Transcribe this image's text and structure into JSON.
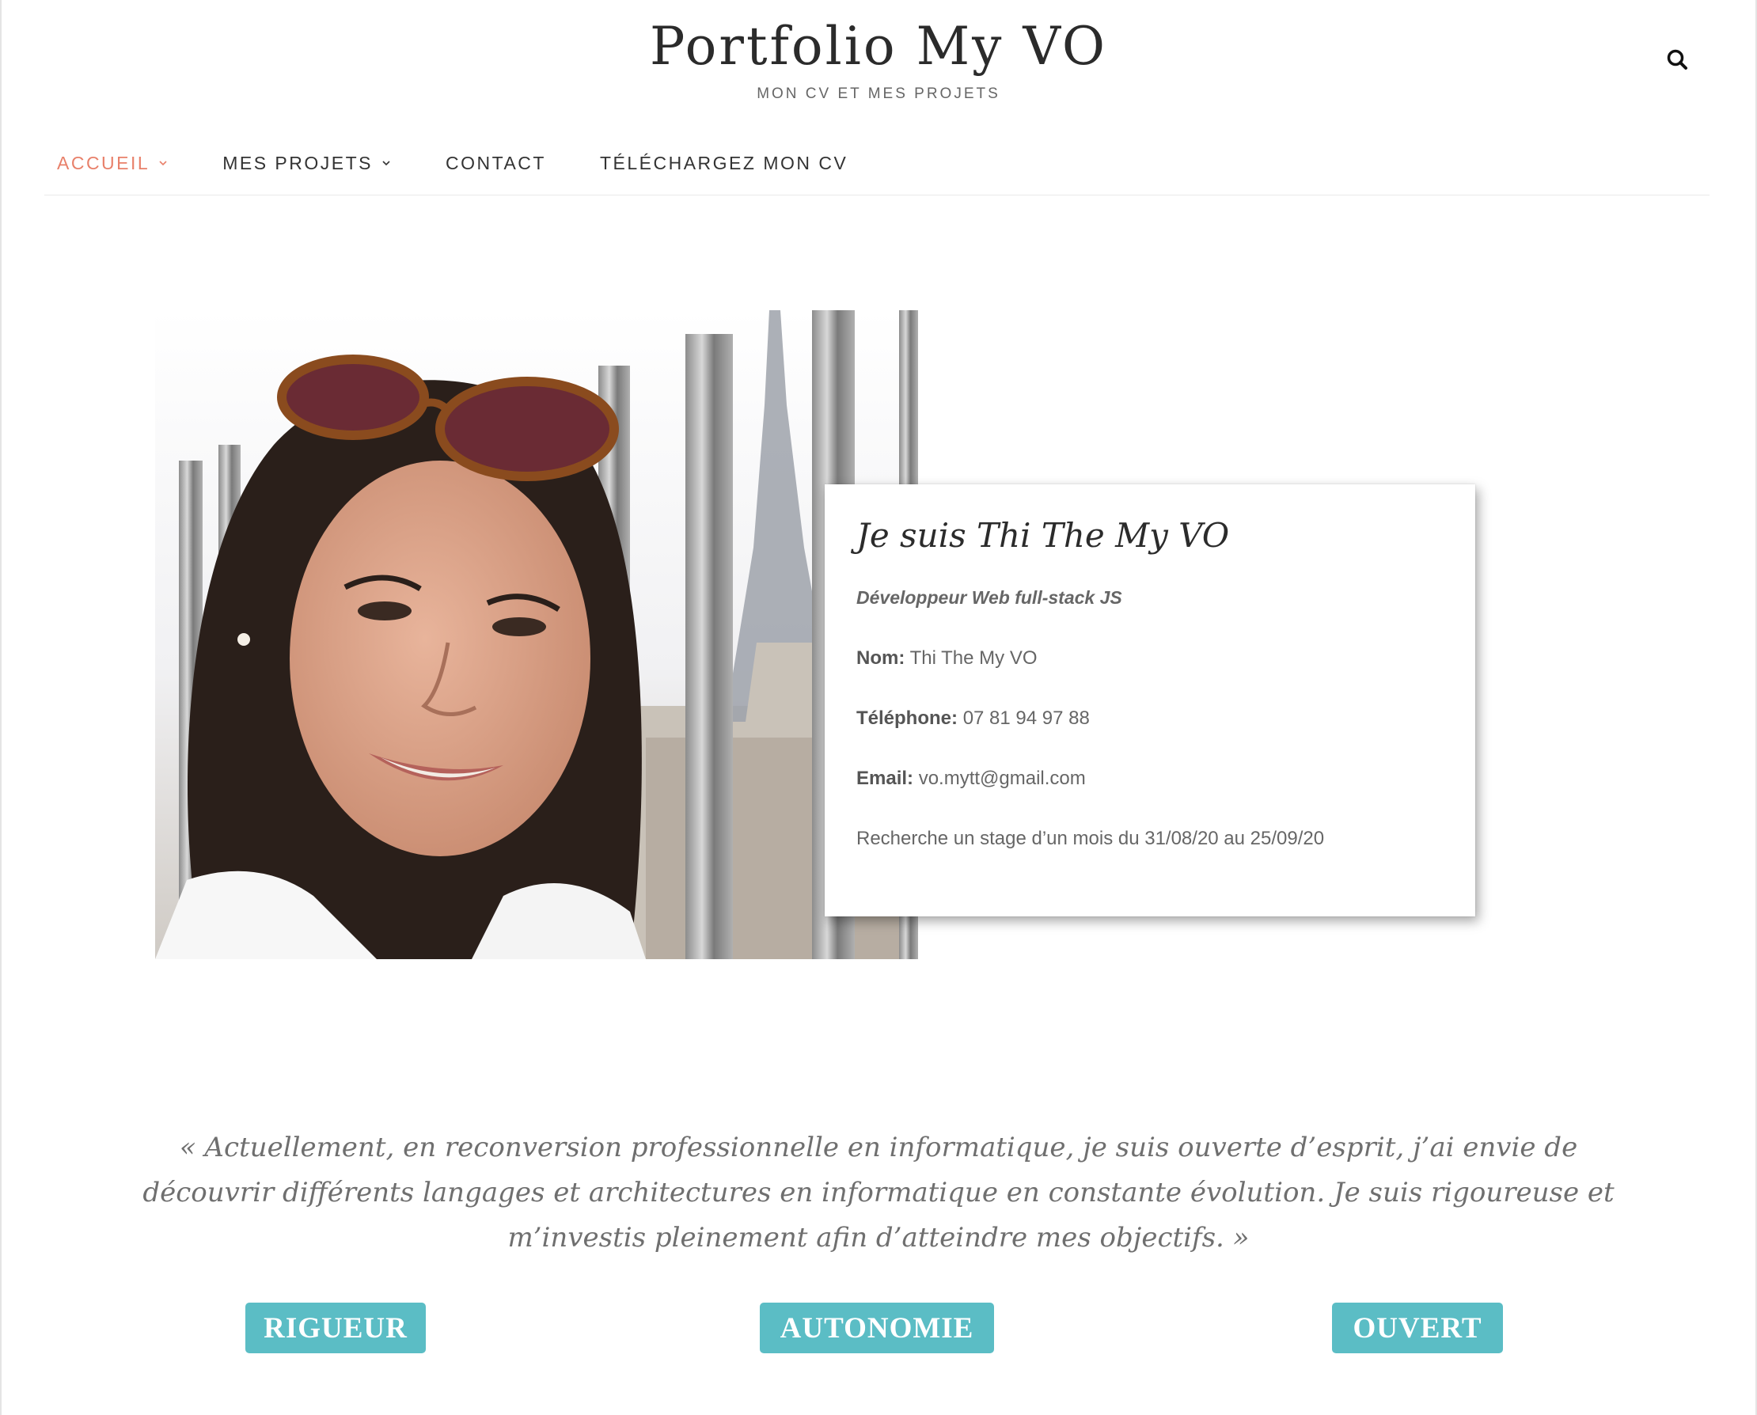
{
  "header": {
    "site_title": "Portfolio My VO",
    "tagline": "MON CV ET MES PROJETS",
    "search_icon": "search-icon"
  },
  "nav": {
    "items": [
      {
        "label": "ACCUEIL",
        "has_dropdown": true,
        "active": true
      },
      {
        "label": "MES PROJETS",
        "has_dropdown": true,
        "active": false
      },
      {
        "label": "CONTACT",
        "has_dropdown": false,
        "active": false
      },
      {
        "label": "TÉLÉCHARGEZ MON CV",
        "has_dropdown": false,
        "active": false
      }
    ],
    "active_color": "#e8806a"
  },
  "profile": {
    "title": "Je suis Thi The My VO",
    "role": "Développeur Web full-stack JS",
    "name_label": "Nom:",
    "name_value": "Thi The My VO",
    "phone_label": "Téléphone:",
    "phone_value": "07 81 94 97 88",
    "email_label": "Email:",
    "email_value": "vo.mytt@gmail.com",
    "note": "Recherche un stage d’un mois du 31/08/20 au 25/09/20"
  },
  "quote": "« Actuellement, en reconversion professionnelle en informatique, je suis ouverte d’esprit, j’ai envie de découvrir différents langages et architectures en informatique en constante évolution. Je suis rigoureuse et m’investis pleinement afin d’atteindre mes objectifs. »",
  "qualities": [
    {
      "label": "RIGUEUR"
    },
    {
      "label": "AUTONOMIE"
    },
    {
      "label": "OUVERT"
    }
  ],
  "colors": {
    "accent": "#5bbdc5",
    "nav_active": "#e8806a"
  }
}
